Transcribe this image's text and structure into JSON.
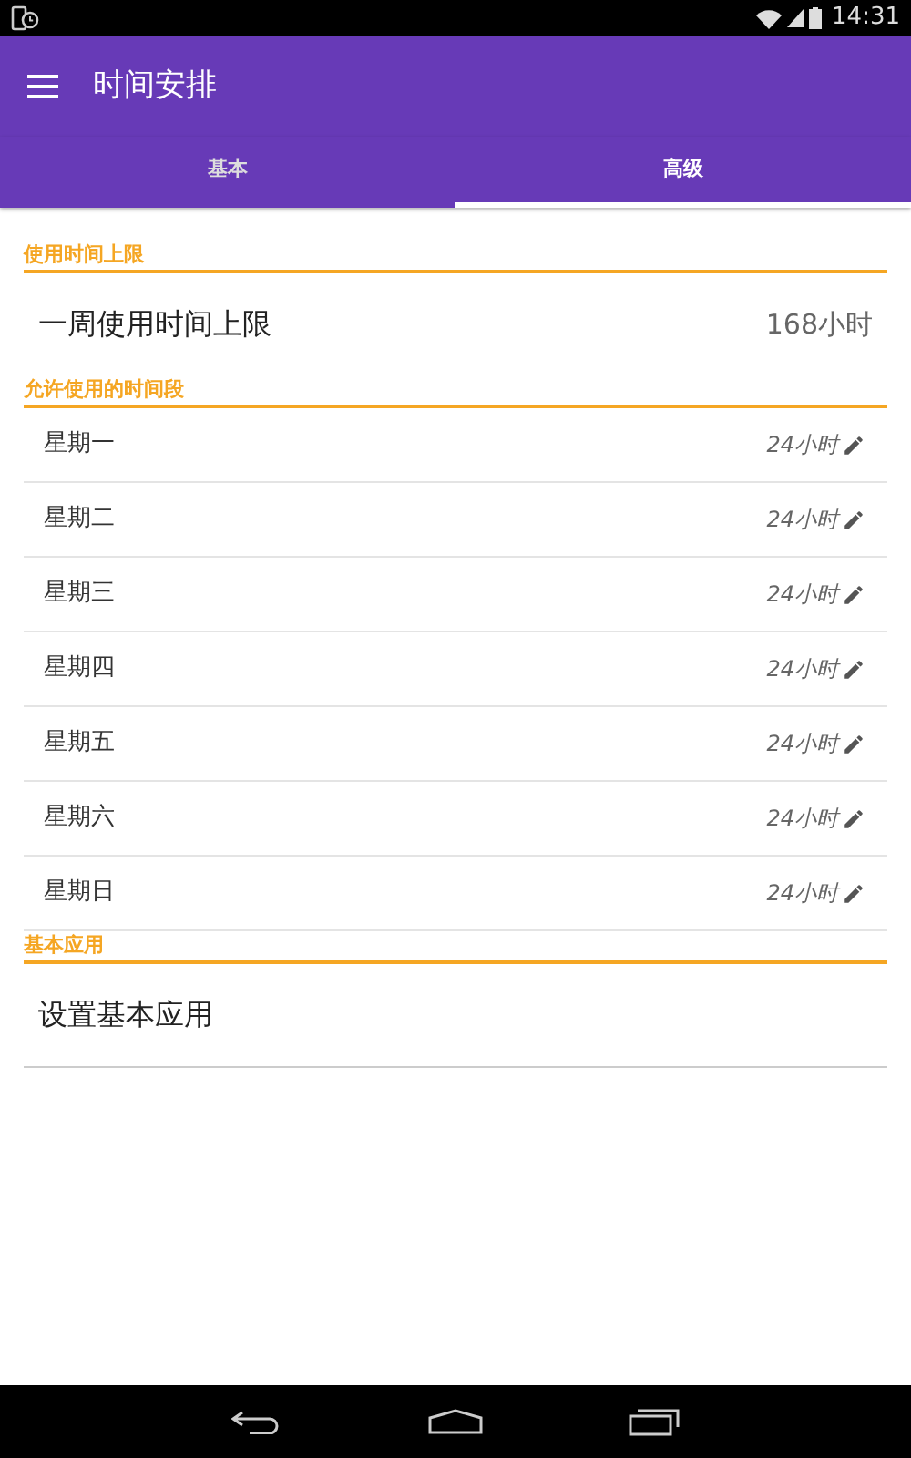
{
  "status_bar": {
    "time": "14:31"
  },
  "app_bar": {
    "title": "时间安排"
  },
  "tabs": [
    {
      "label": "基本",
      "selected": false
    },
    {
      "label": "高级",
      "selected": true
    }
  ],
  "sections": [
    {
      "header": "使用时间上限",
      "items": [
        {
          "kind": "large",
          "label": "一周使用时间上限",
          "value": "168小时"
        }
      ]
    },
    {
      "header": "允许使用的时间段",
      "items": [
        {
          "kind": "day",
          "label": "星期一",
          "value": "24小时"
        },
        {
          "kind": "day",
          "label": "星期二",
          "value": "24小时"
        },
        {
          "kind": "day",
          "label": "星期三",
          "value": "24小时"
        },
        {
          "kind": "day",
          "label": "星期四",
          "value": "24小时"
        },
        {
          "kind": "day",
          "label": "星期五",
          "value": "24小时"
        },
        {
          "kind": "day",
          "label": "星期六",
          "value": "24小时"
        },
        {
          "kind": "day",
          "label": "星期日",
          "value": "24小时"
        }
      ]
    },
    {
      "header": "基本应用",
      "items": [
        {
          "kind": "large",
          "label": "设置基本应用"
        }
      ]
    }
  ]
}
